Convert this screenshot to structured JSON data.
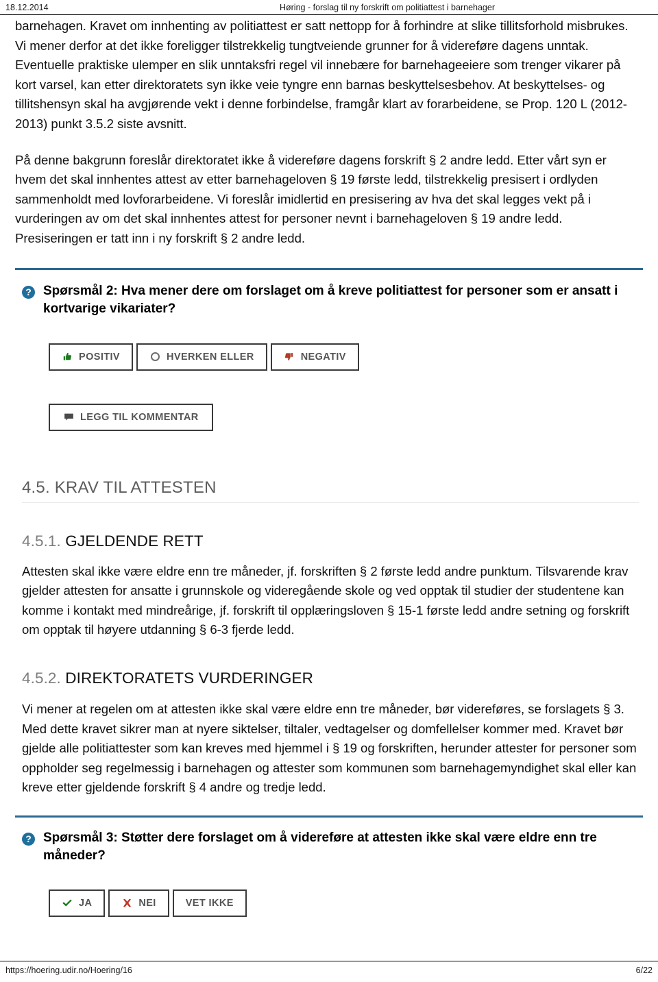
{
  "header": {
    "date": "18.12.2014",
    "title": "Høring - forslag til ny forskrift om politiattest i barnehager"
  },
  "colors": {
    "blue_rule": "#2d6893",
    "question_icon": "#1f6f9c",
    "positive": "#1e7a1e",
    "negative": "#b03a26",
    "yes_check": "#1a7a1a",
    "no_cross": "#c0392b",
    "heading_gray": "#5d5d5d"
  },
  "content": {
    "paragraph_1": "barnehagen. Kravet om innhenting av politiattest er satt nettopp for å forhindre at slike tillitsforhold misbrukes. Vi mener derfor at det ikke foreligger tilstrekkelig tungtveiende grunner for å videreføre dagens unntak. Eventuelle praktiske ulemper en slik unntaksfri regel vil innebære for barnehageeiere som trenger vikarer på kort varsel, kan etter direktoratets syn ikke veie tyngre enn barnas beskyttelsesbehov. At beskyttelses- og tillitshensyn skal ha avgjørende vekt i denne forbindelse, framgår klart av forarbeidene, se Prop. 120 L (2012-2013) punkt 3.5.2 siste avsnitt.",
    "paragraph_2": "På denne bakgrunn foreslår direktoratet ikke å videreføre dagens forskrift § 2 andre ledd. Etter vårt syn er hvem det skal innhentes attest av etter barnehageloven § 19 første ledd, tilstrekkelig presisert i ordlyden sammenholdt med lovforarbeidene. Vi foreslår imidlertid en presisering av hva det skal legges vekt på i vurderingen av om det skal innhentes attest for personer nevnt i barnehageloven § 19 andre ledd. Presiseringen er tatt inn i ny forskrift § 2 andre ledd."
  },
  "question_2": {
    "icon": "question-mark-circle-icon",
    "text": "Spørsmål 2: Hva mener dere om forslaget om å kreve politiattest for personer som er ansatt i kortvarige vikariater?",
    "options": [
      {
        "label": "POSITIV",
        "icon": "thumbs-up-icon"
      },
      {
        "label": "HVERKEN ELLER",
        "icon": "circle-icon"
      },
      {
        "label": "NEGATIV",
        "icon": "thumbs-down-icon"
      }
    ],
    "comment_button": {
      "label": "LEGG TIL KOMMENTAR",
      "icon": "speech-bubble-icon"
    }
  },
  "section_45": {
    "heading": "4.5. KRAV TIL ATTESTEN"
  },
  "section_451": {
    "number": "4.5.1.",
    "title": "GJELDENDE RETT",
    "body": "Attesten skal ikke være eldre enn tre måneder, jf. forskriften § 2 første ledd andre punktum. Tilsvarende krav gjelder attesten for ansatte i grunnskole og videregående skole og ved opptak til studier der studentene kan komme i kontakt med mindreårige, jf. forskrift til opplæringsloven § 15-1 første ledd andre setning og forskrift om opptak til høyere utdanning § 6-3 fjerde ledd."
  },
  "section_452": {
    "number": "4.5.2.",
    "title": "DIREKTORATETS VURDERINGER",
    "body": "Vi mener at regelen om at attesten ikke skal være eldre enn tre måneder, bør videreføres, se forslagets § 3. Med dette kravet sikrer man at nyere siktelser, tiltaler, vedtagelser og domfellelser kommer med. Kravet bør gjelde alle politiattester som kan kreves med hjemmel i § 19 og forskriften, herunder attester for personer som oppholder seg regelmessig i barnehagen og attester som kommunen som barnehagemyndighet skal eller kan kreve etter gjeldende forskrift § 4 andre og tredje ledd."
  },
  "question_3": {
    "icon": "question-mark-circle-icon",
    "text": "Spørsmål 3: Støtter dere forslaget om å videreføre at attesten ikke skal være eldre enn tre måneder?",
    "options": [
      {
        "label": "JA",
        "icon": "check-icon"
      },
      {
        "label": "NEI",
        "icon": "cross-icon"
      },
      {
        "label": "VET IKKE",
        "icon": "none"
      }
    ]
  },
  "footer": {
    "url": "https://hoering.udir.no/Hoering/16",
    "page": "6/22"
  }
}
